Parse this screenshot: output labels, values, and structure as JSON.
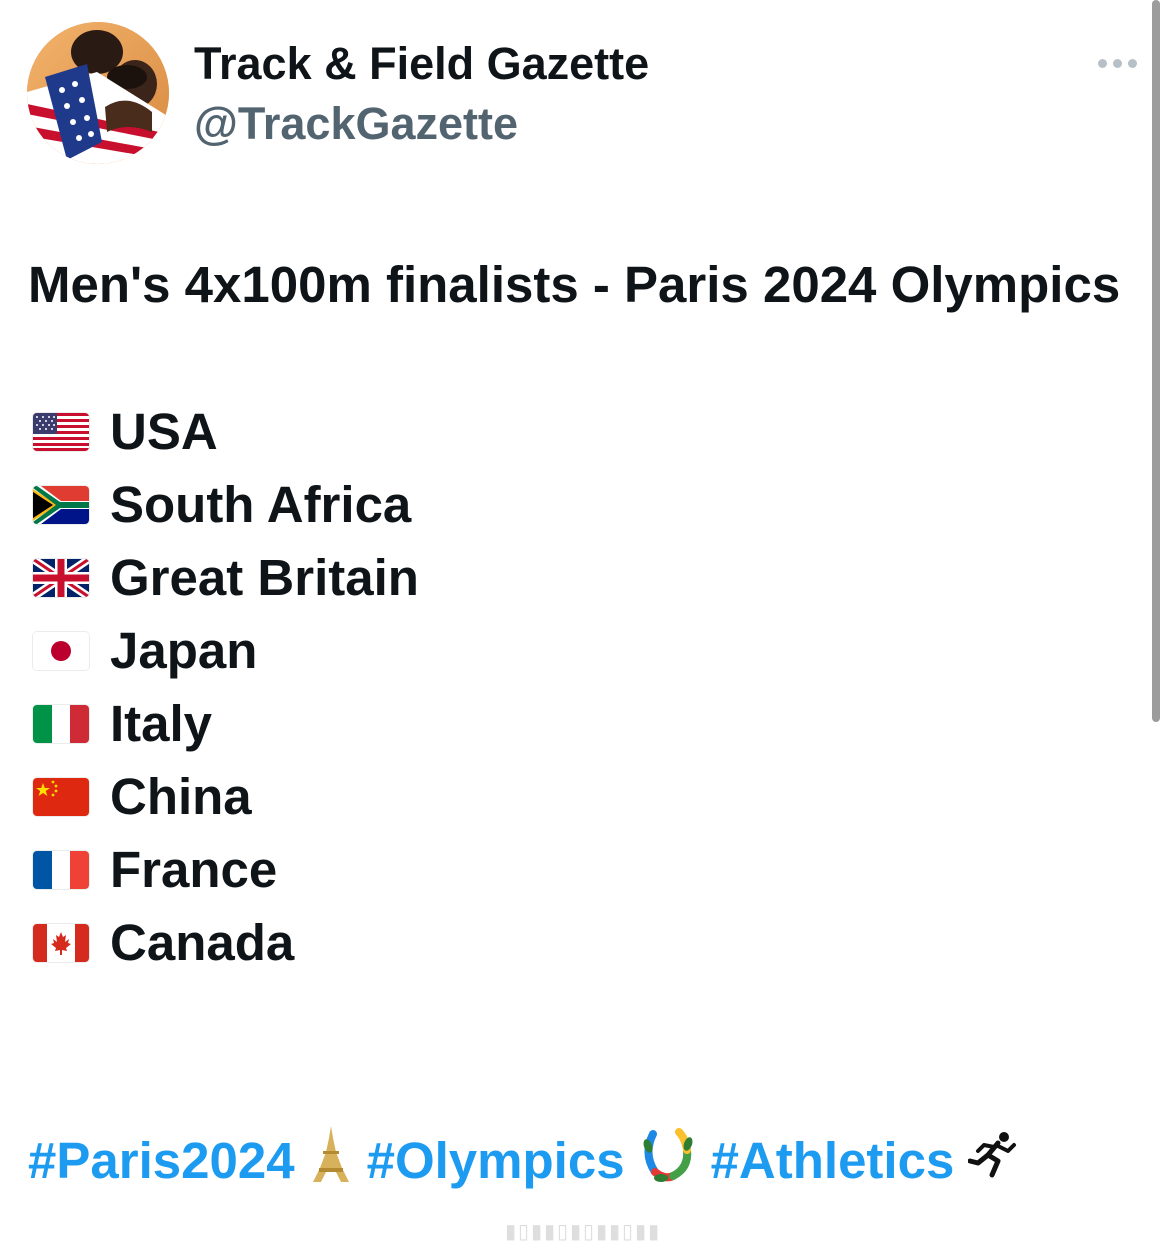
{
  "author": {
    "display_name": "Track & Field Gazette",
    "handle": "@TrackGazette",
    "avatar": "avatar-photo-athletes-with-us-flag"
  },
  "menu": {
    "icon": "more-dots-icon"
  },
  "tweet": {
    "headline": "Men's 4x100m finalists - Paris 2024 Olympics",
    "finalists": [
      {
        "flag": "us-flag-icon",
        "country": "USA"
      },
      {
        "flag": "south-africa-flag-icon",
        "country": "South Africa"
      },
      {
        "flag": "uk-flag-icon",
        "country": "Great Britain"
      },
      {
        "flag": "japan-flag-icon",
        "country": "Japan"
      },
      {
        "flag": "italy-flag-icon",
        "country": "Italy"
      },
      {
        "flag": "china-flag-icon",
        "country": "China"
      },
      {
        "flag": "france-flag-icon",
        "country": "France"
      },
      {
        "flag": "canada-flag-icon",
        "country": "Canada"
      }
    ],
    "hashtags": [
      {
        "tag": "#Paris2024",
        "emoji": "eiffel-tower-icon"
      },
      {
        "tag": "#Olympics",
        "emoji": "laurel-wreath-icon"
      },
      {
        "tag": "#Athletics",
        "emoji": "runner-icon"
      }
    ]
  },
  "colors": {
    "text": "#0f1419",
    "handle": "#536471",
    "link": "#1d9bf0",
    "menu_dots": "#b8c0c7"
  }
}
